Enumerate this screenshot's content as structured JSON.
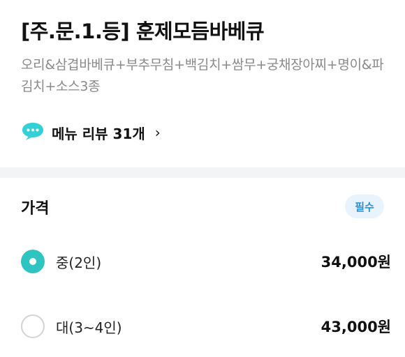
{
  "menu": {
    "title": "[주.문.1.등] 훈제모듬바베큐",
    "description": "오리&삼겹바베큐+부추무침+백김치+쌈무+궁채장아찌+명이&파김치+소스3종",
    "review_label": "메뉴 리뷰 31개",
    "review_icon": "speech-bubble-icon",
    "chevron": "›"
  },
  "price_section": {
    "title": "가격",
    "badge": "필수",
    "options": [
      {
        "label": "중(2인)",
        "price": "34,000원",
        "selected": true
      },
      {
        "label": "대(3~4인)",
        "price": "43,000원",
        "selected": false
      }
    ]
  },
  "colors": {
    "accent_teal": "#2ec4c0",
    "badge_blue": "#2b8fdc",
    "badge_bg": "#e9f3fd"
  }
}
